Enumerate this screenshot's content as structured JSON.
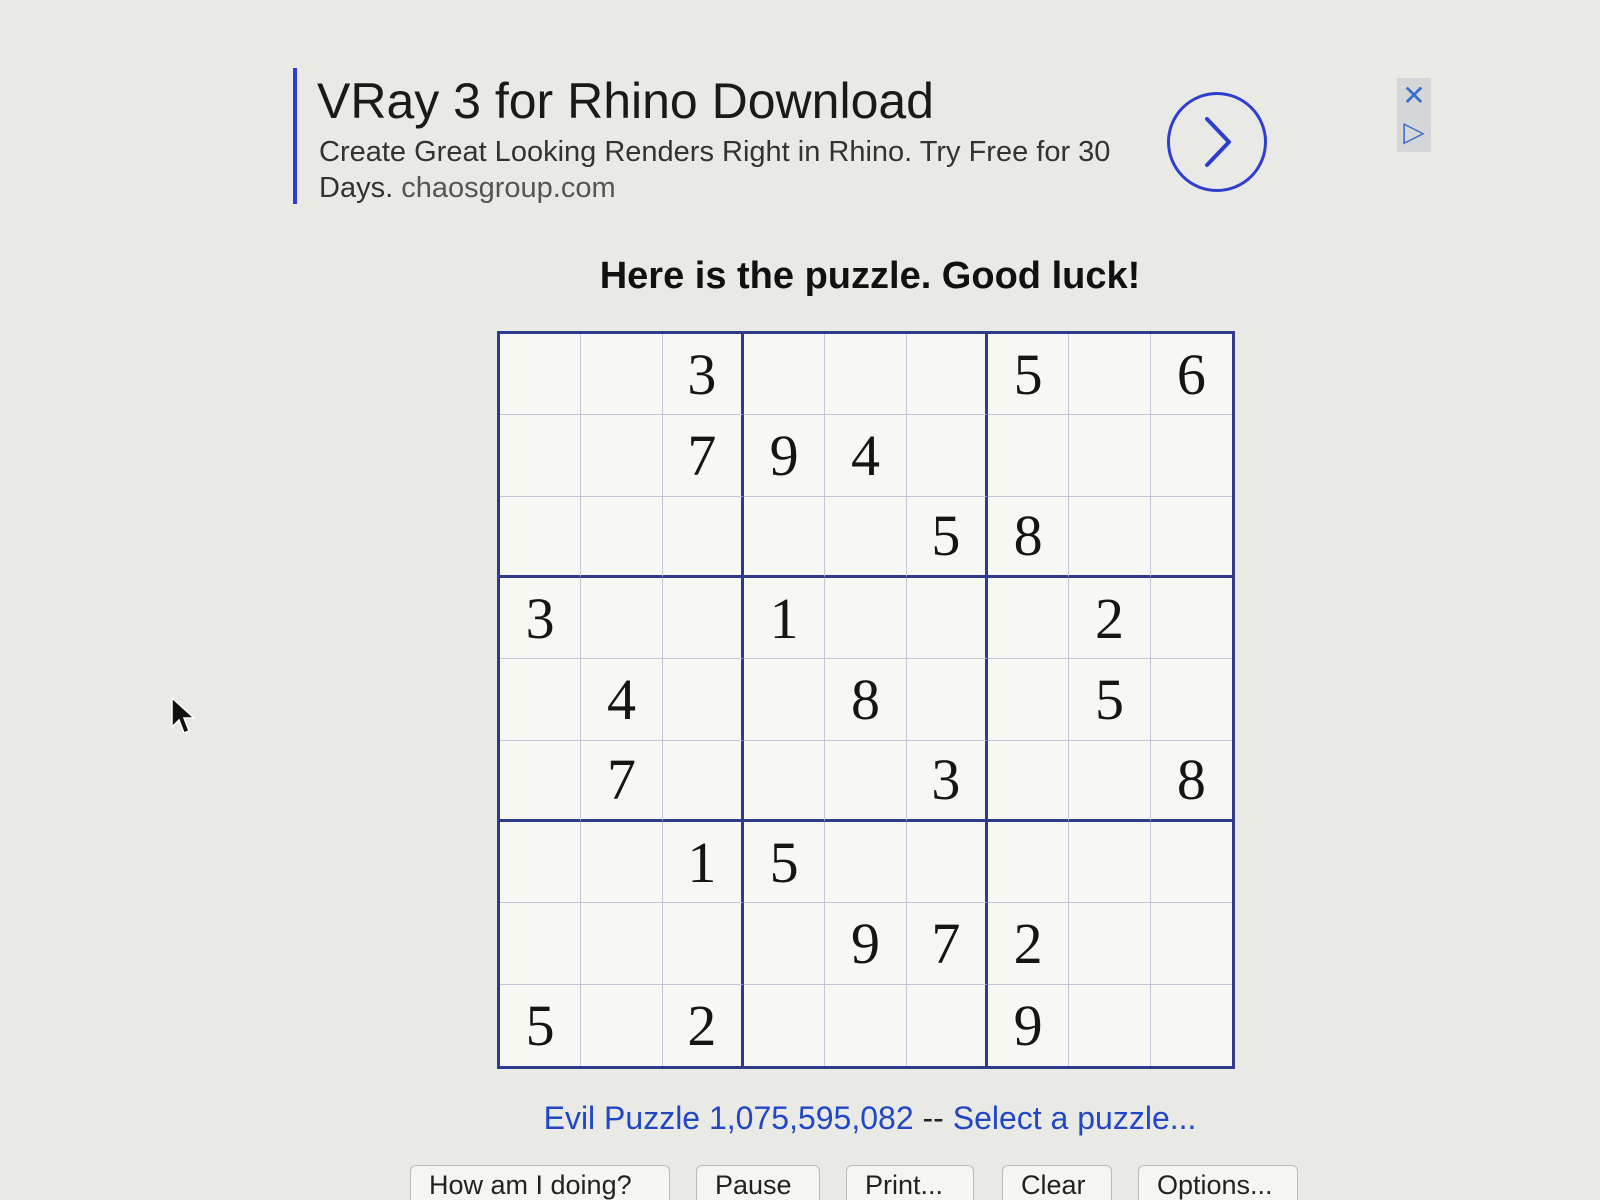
{
  "ad": {
    "title": "VRay 3 for Rhino Download",
    "description": "Create Great Looking Renders Right in Rhino. Try Free for 30 Days.",
    "domain": "chaosgroup.com",
    "arrow_icon": "chevron-right-icon",
    "close_icon": "close-icon",
    "adchoices_icon": "adchoices-icon",
    "accent_color": "#2e3fd0"
  },
  "heading": "Here is the puzzle. Good luck!",
  "grid": {
    "rows": [
      [
        "",
        "",
        "3",
        "",
        "",
        "",
        "5",
        "",
        "6"
      ],
      [
        "",
        "",
        "7",
        "9",
        "4",
        "",
        "",
        "",
        ""
      ],
      [
        "",
        "",
        "",
        "",
        "",
        "5",
        "8",
        "",
        ""
      ],
      [
        "3",
        "",
        "",
        "1",
        "",
        "",
        "",
        "2",
        ""
      ],
      [
        "",
        "4",
        "",
        "",
        "8",
        "",
        "",
        "5",
        ""
      ],
      [
        "",
        "7",
        "",
        "",
        "",
        "3",
        "",
        "",
        "8"
      ],
      [
        "",
        "",
        "1",
        "5",
        "",
        "",
        "",
        "",
        ""
      ],
      [
        "",
        "",
        "",
        "",
        "9",
        "7",
        "2",
        "",
        ""
      ],
      [
        "5",
        "",
        "2",
        "",
        "",
        "",
        "9",
        "",
        ""
      ]
    ],
    "border_color": "#2e3a8a"
  },
  "puzzle_info": {
    "label": "Evil Puzzle 1,075,595,082",
    "separator": "--",
    "select_link": "Select a puzzle...",
    "link_color": "#2147c4"
  },
  "buttons": {
    "how_am_i_doing": "How am I doing?",
    "pause": "Pause",
    "print": "Print...",
    "clear": "Clear",
    "options": "Options..."
  }
}
